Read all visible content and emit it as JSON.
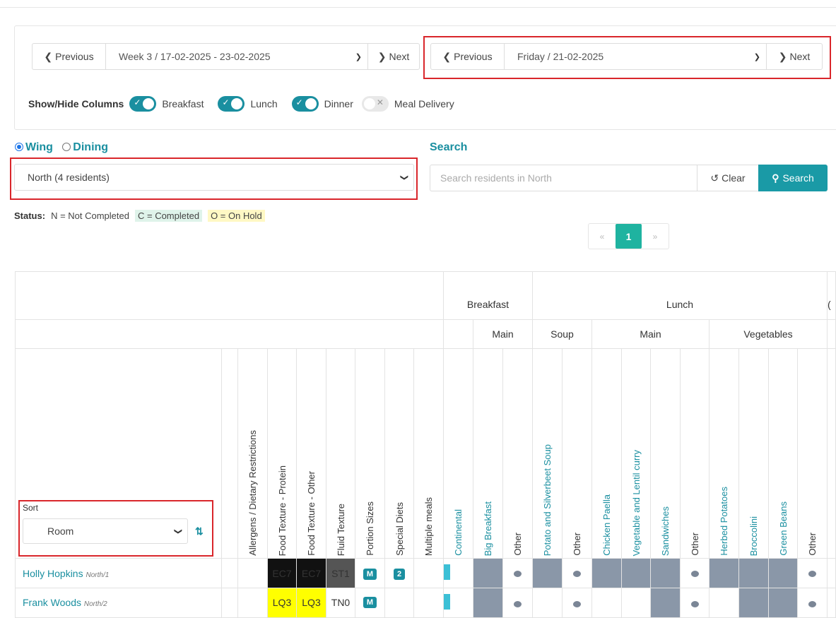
{
  "week_nav": {
    "prev_label": "Previous",
    "selected": "Week 3 / 17-02-2025 - 23-02-2025",
    "next_label": "Next"
  },
  "day_nav": {
    "prev_label": "Previous",
    "selected": "Friday / 21-02-2025",
    "next_label": "Next"
  },
  "columns_toggle": {
    "label": "Show/Hide Columns",
    "items": [
      {
        "label": "Breakfast",
        "on": true
      },
      {
        "label": "Lunch",
        "on": true
      },
      {
        "label": "Dinner",
        "on": true
      },
      {
        "label": "Meal Delivery",
        "on": false
      }
    ]
  },
  "filter": {
    "wing_label": "Wing",
    "dining_label": "Dining",
    "selected_mode": "Wing",
    "wing_selected": "North (4 residents)"
  },
  "search": {
    "heading": "Search",
    "placeholder": "Search residents in North",
    "clear_label": "Clear",
    "search_label": "Search"
  },
  "status_legend": {
    "label": "Status:",
    "n": "N = Not Completed",
    "c": "C = Completed",
    "o": "O = On Hold"
  },
  "pagination": {
    "prev": "«",
    "current": "1",
    "next": "»"
  },
  "sort": {
    "label": "Sort",
    "selected": "Room"
  },
  "table": {
    "groups": {
      "breakfast": "Breakfast",
      "lunch": "Lunch",
      "partial": "("
    },
    "subgroups": {
      "b_main": "Main",
      "soup": "Soup",
      "l_main": "Main",
      "veg": "Vegetables"
    },
    "info_columns": [
      "Allergens / Dietary Restrictions",
      "Food Texture - Protein",
      "Food Texture - Other",
      "Fluid Texture",
      "Portion Sizes",
      "Special Diets",
      "Multiple meals"
    ],
    "meal_columns": [
      "Continental",
      "Big Breakfast",
      "Other",
      "Potato and Silverbeet Soup",
      "Other",
      "Chicken Paella",
      "Vegetable and Lentil curry",
      "Sandwiches",
      "Other",
      "Herbed Potatoes",
      "Broccolini",
      "Green Beans",
      "Other"
    ],
    "rows": [
      {
        "name": "Holly Hopkins",
        "room": "North/1",
        "protein": "EC7",
        "other": "EC7",
        "fluid": "ST1",
        "portion": "M",
        "diets": "2"
      },
      {
        "name": "Frank Woods",
        "room": "North/2",
        "protein": "LQ3",
        "other": "LQ3",
        "fluid": "TN0",
        "portion": "M",
        "diets": ""
      }
    ]
  },
  "colors": {
    "teal": "#1a8fa0",
    "highlight": "#d9262b",
    "cell_grey": "#8a97a8",
    "black_tex": "#111111",
    "yellow_tex": "#ffff00",
    "fluid_tex": "#555555"
  }
}
